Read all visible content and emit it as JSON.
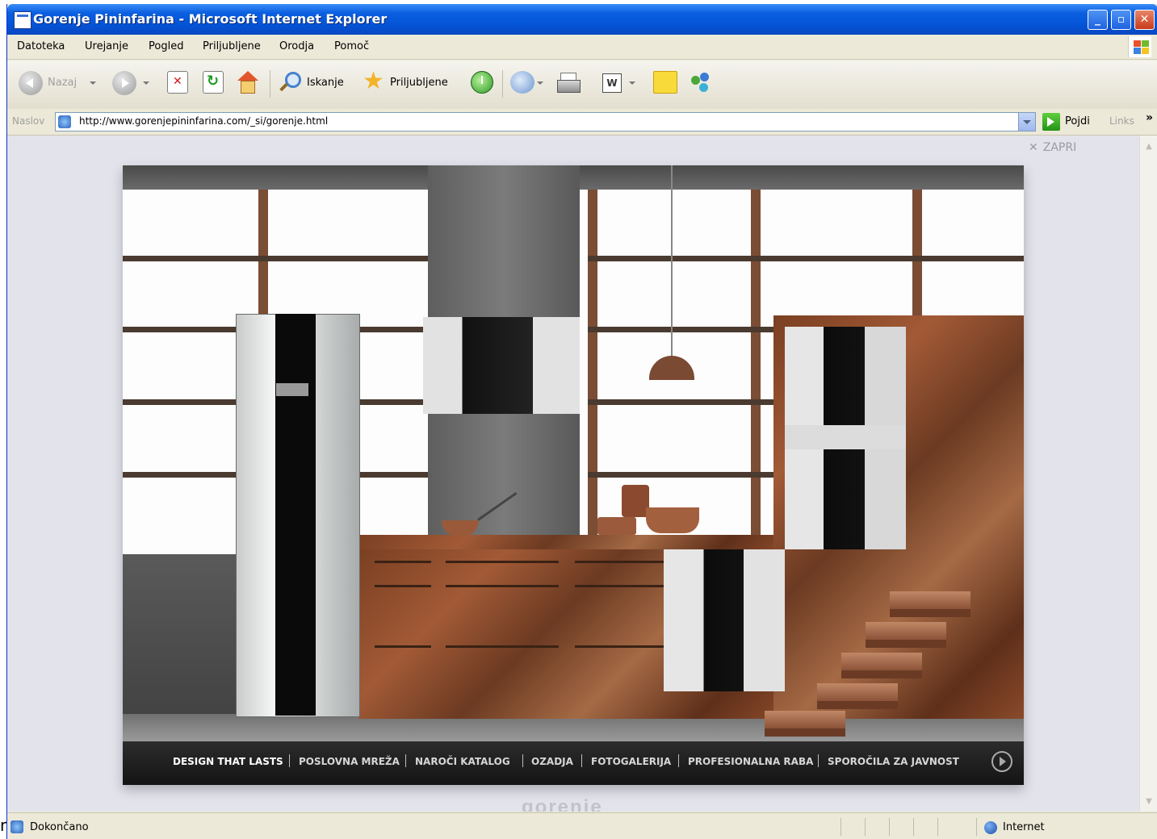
{
  "window": {
    "title": "Gorenje Pininfarina - Microsoft Internet Explorer",
    "min_label": "_",
    "max_label": "▫",
    "close_label": "✕"
  },
  "menu": {
    "items": [
      "Datoteka",
      "Urejanje",
      "Pogled",
      "Priljubljene",
      "Orodja",
      "Pomoč"
    ]
  },
  "toolbar": {
    "back_label": "Nazaj",
    "search_label": "Iskanje",
    "favorites_label": "Priljubljene",
    "word_label": "W"
  },
  "address": {
    "label": "Naslov",
    "url": "http://www.gorenjepininfarina.com/_si/gorenje.html",
    "go_label": "Pojdi",
    "links_label": "Links",
    "more_label": "»"
  },
  "page": {
    "close_label": "ZAPRI",
    "close_glyph": "✕",
    "nav_links": [
      "DESIGN THAT LASTS",
      "POSLOVNA MREŽA",
      "NAROČI KATALOG",
      "OZADJA",
      "FOTOGALERIJA",
      "PROFESIONALNA RABA",
      "SPOROČILA ZA JAVNOST"
    ],
    "watermark": "gorenje"
  },
  "status": {
    "text": "Dokončano",
    "zone": "Internet"
  },
  "artifact_char": "n",
  "colors": {
    "titlebar": "#0453d6",
    "chrome": "#ece9d8",
    "page_bg": "#e3e3ec",
    "footer_bar": "#141414"
  }
}
